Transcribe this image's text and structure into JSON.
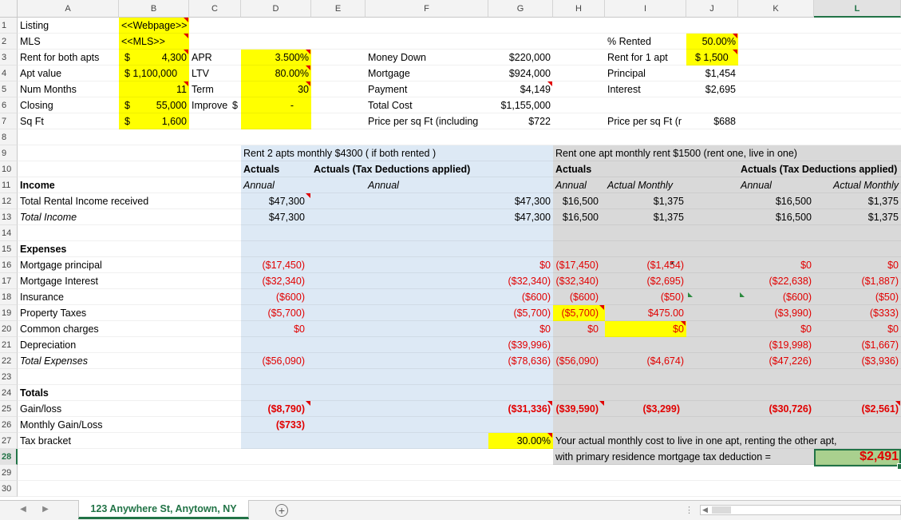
{
  "columns": [
    "A",
    "B",
    "C",
    "D",
    "E",
    "F",
    "G",
    "H",
    "I",
    "J",
    "K",
    "L"
  ],
  "selected_column": "L",
  "selected_row": 28,
  "rows": [
    "1",
    "2",
    "3",
    "4",
    "5",
    "6",
    "7",
    "8",
    "9",
    "10",
    "11",
    "12",
    "13",
    "14",
    "15",
    "16",
    "17",
    "18",
    "19",
    "20",
    "21",
    "22",
    "23",
    "24",
    "25",
    "26",
    "27",
    "28",
    "29",
    "30"
  ],
  "colors": {
    "yellow": "#ffff00",
    "blue_block": "#dde9f5",
    "gray_block": "#d9d9d9",
    "green_cell": "#a9d08e",
    "red_text": "#e10000",
    "accent": "#217346"
  },
  "cells": {
    "A1": "Listing",
    "B1": "<<Webpage>>",
    "A2": "MLS",
    "B2": "<<MLS>>",
    "A3": "Rent for both apts",
    "B3_cur": "$",
    "B3": "4,300",
    "A4": "Apt value",
    "B4": "$ 1,100,000",
    "A5": "Num Months",
    "B5": "11",
    "A6": "Closing",
    "B6_cur": "$",
    "B6": "55,000",
    "A7": "Sq Ft",
    "B7_cur": "$",
    "B7": "1,600",
    "C3": "APR",
    "D3": "3.500%",
    "C4": "LTV",
    "D4": "80.00%",
    "C5": "Term",
    "D5": "30",
    "C6": "Improve",
    "D6_cur": "$",
    "D6": "-",
    "F3": "Money Down",
    "G3": "$220,000",
    "F4": "Mortgage",
    "G4": "$924,000",
    "F5": "Payment",
    "G5": "$4,149",
    "F6": "Total Cost",
    "G6": "$1,155,000",
    "F7": "Price per sq Ft (including",
    "G7": "$722",
    "I2": "% Rented",
    "J2": "50.00%",
    "I3": "Rent for 1 apt",
    "J3": "$ 1,500",
    "I4": "Principal",
    "J4": "$1,454",
    "I5": "Interest",
    "J5": "$2,695",
    "I7": "Price per sq Ft (r",
    "J7": "$688",
    "D9": "Rent 2 apts monthly $4300 ( if both rented )",
    "H9": "Rent one apt monthly rent $1500 (rent one, live in one)",
    "D10": "Actuals",
    "E10": "Actuals (Tax Deductions applied)",
    "H10": "Actuals",
    "K10": "Actuals (Tax Deductions applied)",
    "A11": "Income",
    "D11": "Annual",
    "F11": "Annual",
    "H11": "Annual",
    "I11": "Actual Monthly",
    "K11": "Annual",
    "L11": "Actual Monthly",
    "A12": "Total Rental Income received",
    "D12": "$47,300",
    "G12": "$47,300",
    "H12": "$16,500",
    "I12": "$1,375",
    "K12": "$16,500",
    "L12": "$1,375",
    "A13": "Total Income",
    "D13": "$47,300",
    "G13": "$47,300",
    "H13": "$16,500",
    "I13": "$1,375",
    "K13": "$16,500",
    "L13": "$1,375",
    "A15": "Expenses",
    "A16": "Mortgage principal",
    "D16": "($17,450)",
    "G16": "$0",
    "H16": "($17,450)",
    "I16": "($1,454)",
    "I16_note": "*",
    "K16": "$0",
    "L16": "$0",
    "A17": "Mortgage Interest",
    "D17": "($32,340)",
    "G17": "($32,340)",
    "H17": "($32,340)",
    "I17": "($2,695)",
    "K17": "($22,638)",
    "L17": "($1,887)",
    "A18": "Insurance",
    "D18": "($600)",
    "G18": "($600)",
    "H18": "($600)",
    "I18": "($50)",
    "K18": "($600)",
    "L18": "($50)",
    "A19": "Property Taxes",
    "D19": "($5,700)",
    "G19": "($5,700)",
    "H19": "($5,700)",
    "I19": "$475.00",
    "K19": "($3,990)",
    "L19": "($333)",
    "A20": "Common charges",
    "D20": "$0",
    "G20": "$0",
    "H20": "$0",
    "I20": "$0",
    "K20": "$0",
    "L20": "$0",
    "A21": "Depreciation",
    "G21": "($39,996)",
    "K21": "($19,998)",
    "L21": "($1,667)",
    "A22": "Total Expenses",
    "D22": "($56,090)",
    "G22": "($78,636)",
    "H22": "($56,090)",
    "I22": "($4,674)",
    "K22": "($47,226)",
    "L22": "($3,936)",
    "A24": "Totals",
    "A25": "Gain/loss",
    "D25": "($8,790)",
    "G25": "($31,336)",
    "H25": "($39,590)",
    "I25": "($3,299)",
    "K25": "($30,726)",
    "L25": "($2,561)",
    "A26": "Monthly Gain/Loss",
    "D26": "($733)",
    "A27": "Tax bracket",
    "G27": "30.00%",
    "H27": "Your actual monthly cost to live in one apt, renting the other apt,",
    "H28": "with primary residence mortgage tax deduction =",
    "L28": "$2,491"
  },
  "sheet_tab": "123 Anywhere St, Anytown, NY",
  "icons": {
    "nav_prev": "◀",
    "nav_next": "▶",
    "add_sheet": "+",
    "scroll_sep": "⋮",
    "scroll_left": "◀"
  }
}
